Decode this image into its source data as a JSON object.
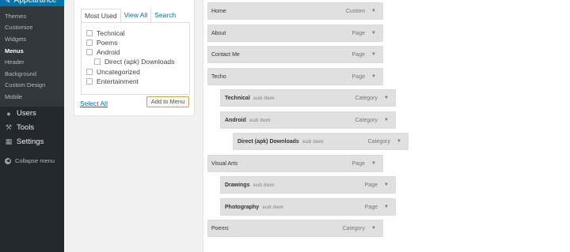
{
  "sidebar": {
    "appearance_label": "Appearance",
    "submenu": [
      {
        "label": "Themes"
      },
      {
        "label": "Customize"
      },
      {
        "label": "Widgets"
      },
      {
        "label": "Menus"
      },
      {
        "label": "Header"
      },
      {
        "label": "Background"
      },
      {
        "label": "Custom Design"
      },
      {
        "label": "Mobile"
      }
    ],
    "users_label": "Users",
    "tools_label": "Tools",
    "settings_label": "Settings",
    "collapse_label": "Collapse menu"
  },
  "categories_panel": {
    "tabs": [
      "Most Used",
      "View All",
      "Search"
    ],
    "items": [
      {
        "label": "Technical",
        "checked": false
      },
      {
        "label": "Poems",
        "checked": false
      },
      {
        "label": "Android",
        "checked": false
      },
      {
        "label": "Direct (apk) Downloads",
        "checked": false
      },
      {
        "label": "Uncategorized",
        "checked": false
      },
      {
        "label": "Entertainment",
        "checked": false
      }
    ],
    "select_all": "Select All",
    "add_button": "Add to Menu"
  },
  "menu_structure": {
    "items": [
      {
        "title": "Home",
        "type": "Custom",
        "sub": ""
      },
      {
        "title": "About",
        "type": "Page",
        "sub": ""
      },
      {
        "title": "Contact Me",
        "type": "Page",
        "sub": ""
      },
      {
        "title": "Techo",
        "type": "Page",
        "sub": ""
      },
      {
        "title": "Technical",
        "type": "Category",
        "sub": "sub item"
      },
      {
        "title": "Android",
        "type": "Category",
        "sub": "sub item"
      },
      {
        "title": "Direct (apk) Downloads",
        "type": "Category",
        "sub": "sub item"
      },
      {
        "title": "Visual Arts",
        "type": "Page",
        "sub": ""
      },
      {
        "title": "Drawings",
        "type": "Page",
        "sub": "sub item"
      },
      {
        "title": "Photography",
        "type": "Page",
        "sub": "sub item"
      },
      {
        "title": "Poems",
        "type": "Category",
        "sub": ""
      }
    ]
  },
  "colors": {
    "accent": "#0073aa",
    "sidebar_bg": "#23282d",
    "item_bg": "#e0e0e0"
  }
}
